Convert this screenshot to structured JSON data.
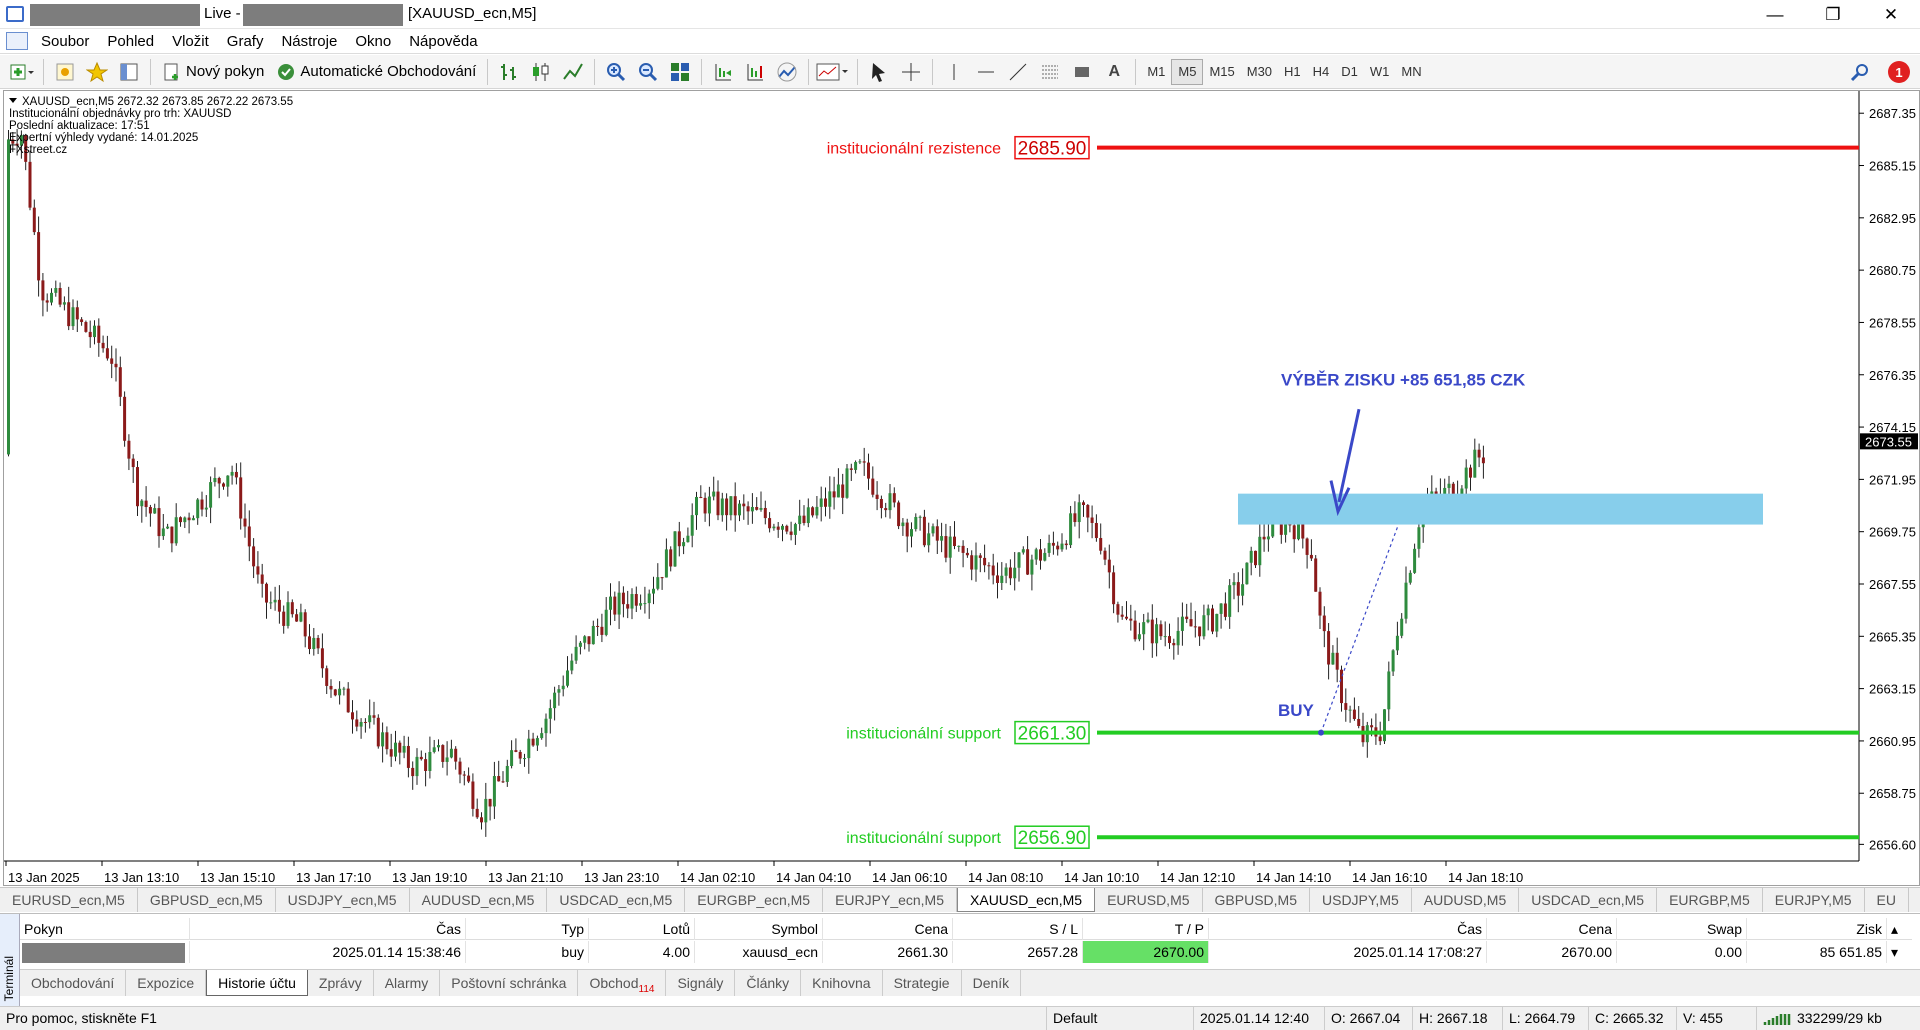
{
  "window": {
    "live_label": "Live -",
    "title": "[XAUUSD_ecn,M5]",
    "controls": [
      "—",
      "❐",
      "✕"
    ]
  },
  "menu": [
    "Soubor",
    "Pohled",
    "Vložit",
    "Grafy",
    "Nástroje",
    "Okno",
    "Nápověda"
  ],
  "toolbar": {
    "new_order": "Nový pokyn",
    "auto_trading": "Automatické Obchodování",
    "timeframes": [
      "M1",
      "M5",
      "M15",
      "M30",
      "H1",
      "H4",
      "D1",
      "W1",
      "MN"
    ],
    "active_timeframe": "M5",
    "text_tool": "A",
    "notifications": "1"
  },
  "chart": {
    "info_lines": [
      "XAUUSD_ecn,M5  2672.32 2673.85 2672.22 2673.55",
      "Institucionální objednávky pro trh: XAUUSD",
      "Poslední aktualizace: 17:51",
      "Expertní výhledy vydané: 14.01.2025",
      "FXstreet.cz"
    ],
    "price_ticks": [
      "2687.35",
      "2685.15",
      "2682.95",
      "2680.75",
      "2678.55",
      "2676.35",
      "2674.15",
      "2671.95",
      "2669.75",
      "2667.55",
      "2665.35",
      "2663.15",
      "2660.95",
      "2658.75",
      "2656.60"
    ],
    "current_price": "2673.55",
    "time_ticks": [
      "13 Jan 2025",
      "13 Jan 13:10",
      "13 Jan 15:10",
      "13 Jan 17:10",
      "13 Jan 19:10",
      "13 Jan 21:10",
      "13 Jan 23:10",
      "14 Jan 02:10",
      "14 Jan 04:10",
      "14 Jan 06:10",
      "14 Jan 08:10",
      "14 Jan 10:10",
      "14 Jan 12:10",
      "14 Jan 14:10",
      "14 Jan 16:10",
      "14 Jan 18:10"
    ],
    "levels": [
      {
        "label": "institucionální rezistence",
        "price": "2685.90",
        "value": 2685.9,
        "color": "#ee1111"
      },
      {
        "label": "institucionální support",
        "price": "2661.30",
        "value": 2661.3,
        "color": "#22cc22"
      },
      {
        "label": "institucionální support",
        "price": "2656.90",
        "value": 2656.9,
        "color": "#22cc22"
      }
    ],
    "annotation_profit": "VÝBĚR ZISKU +85 651,85 CZK",
    "annotation_buy": "BUY",
    "tp_zone": {
      "from": 2670.05,
      "to": 2671.35,
      "color": "#87ceeb"
    },
    "colors": {
      "bull": "#2e8b3e",
      "bear": "#8b1a1a",
      "annotation": "#3a48c8"
    }
  },
  "symbol_tabs": [
    "EURUSD_ecn,M5",
    "GBPUSD_ecn,M5",
    "USDJPY_ecn,M5",
    "AUDUSD_ecn,M5",
    "USDCAD_ecn,M5",
    "EURGBP_ecn,M5",
    "EURJPY_ecn,M5",
    "XAUUSD_ecn,M5",
    "EURUSD,M5",
    "GBPUSD,M5",
    "USDJPY,M5",
    "AUDUSD,M5",
    "USDCAD_ecn,M5",
    "EURGBP,M5",
    "EURJPY,M5",
    "EU"
  ],
  "active_symbol_tab": "XAUUSD_ecn,M5",
  "terminal": {
    "side_label": "Terminál",
    "headers": {
      "order": "Pokyn",
      "time": "Čas",
      "type": "Typ",
      "lots": "Lotů",
      "symbol": "Symbol",
      "price": "Cena",
      "sl": "S / L",
      "tp": "T / P",
      "close_time": "Čas",
      "close_price": "Cena",
      "swap": "Swap",
      "profit": "Zisk"
    },
    "row": {
      "time": "2025.01.14 15:38:46",
      "type": "buy",
      "lots": "4.00",
      "symbol": "xauusd_ecn",
      "price": "2661.30",
      "sl": "2657.28",
      "tp": "2670.00",
      "close_time": "2025.01.14 17:08:27",
      "close_price": "2670.00",
      "swap": "0.00",
      "profit": "85 651.85"
    },
    "tabs": [
      "Obchodování",
      "Expozice",
      "Historie účtu",
      "Zprávy",
      "Alarmy",
      "Poštovní schránka",
      "Obchod",
      "Signály",
      "Články",
      "Knihovna",
      "Strategie",
      "Deník"
    ],
    "trade_badge": "114",
    "active_tab": "Historie účtu"
  },
  "status": {
    "help": "Pro pomoc, stiskněte F1",
    "profile": "Default",
    "datetime": "2025.01.14 12:40",
    "open": "O: 2667.04",
    "high": "H: 2667.18",
    "low": "L: 2664.79",
    "close": "C: 2665.32",
    "volume": "V: 455",
    "traffic": "332299/29 kb"
  }
}
